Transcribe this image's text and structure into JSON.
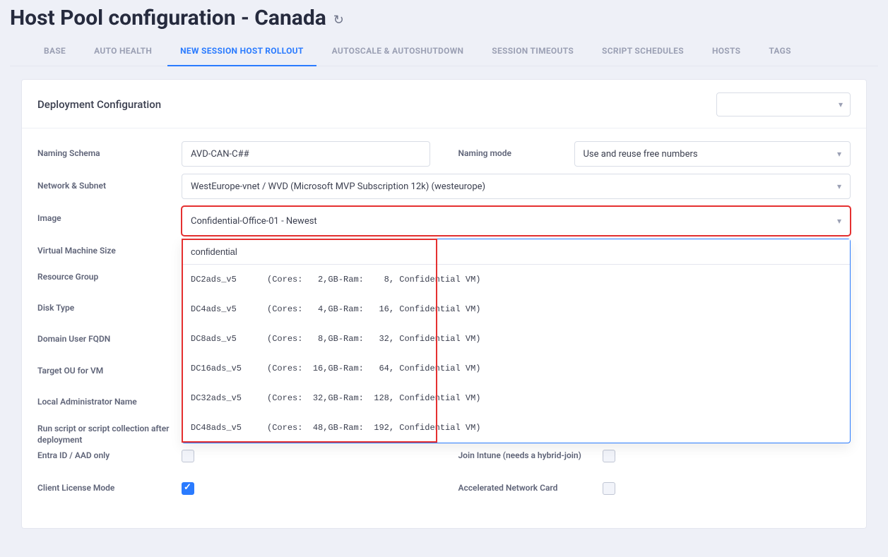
{
  "title": "Host Pool configuration - Canada",
  "tabs": [
    "BASE",
    "AUTO HEALTH",
    "NEW SESSION HOST ROLLOUT",
    "AUTOSCALE & AUTOSHUTDOWN",
    "SESSION TIMEOUTS",
    "SCRIPT SCHEDULES",
    "HOSTS",
    "TAGS"
  ],
  "active_tab_index": 2,
  "section_title": "Deployment Configuration",
  "labels": {
    "naming_schema": "Naming Schema",
    "naming_mode": "Naming mode",
    "network_subnet": "Network & Subnet",
    "image": "Image",
    "vm_size": "Virtual Machine Size",
    "resource_group": "Resource Group",
    "disk_type": "Disk Type",
    "domain_user_fqdn": "Domain User FQDN",
    "target_ou": "Target OU for VM",
    "local_admin": "Local Administrator Name",
    "run_script": "Run script or script collection after deployment",
    "entra_only": "Entra ID / AAD only",
    "join_intune": "Join Intune (needs a hybrid-join)",
    "client_license": "Client License Mode",
    "accel_net": "Accelerated Network Card"
  },
  "values": {
    "naming_schema": "AVD-CAN-C##",
    "naming_mode": "Use and reuse free numbers",
    "network_subnet": "WestEurope-vnet / WVD (Microsoft MVP Subscription 12k) (westeurope)",
    "image": "Confidential-Office-01 - Newest"
  },
  "vm_search": "confidential",
  "vm_options": [
    "DC2ads_v5      (Cores:   2,GB-Ram:    8, Confidential VM)",
    "DC4ads_v5      (Cores:   4,GB-Ram:   16, Confidential VM)",
    "DC8ads_v5      (Cores:   8,GB-Ram:   32, Confidential VM)",
    "DC16ads_v5     (Cores:  16,GB-Ram:   64, Confidential VM)",
    "DC32ads_v5     (Cores:  32,GB-Ram:  128, Confidential VM)",
    "DC48ads_v5     (Cores:  48,GB-Ram:  192, Confidential VM)"
  ],
  "checkboxes": {
    "entra_only": false,
    "join_intune": false,
    "client_license": true,
    "accel_net": false
  }
}
